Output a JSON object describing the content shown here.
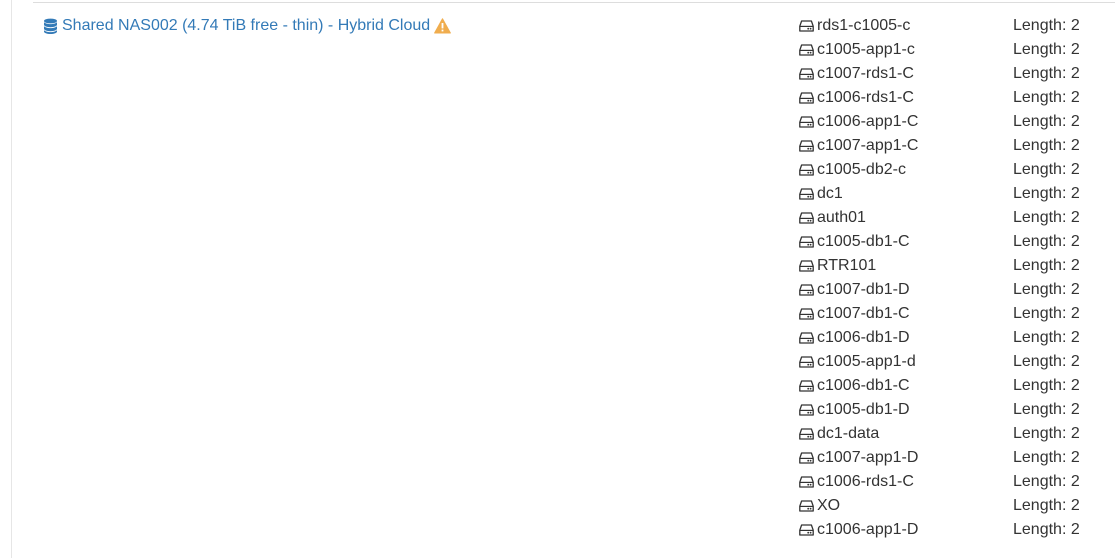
{
  "sr": {
    "name": "Shared NAS002 (4.74 TiB free - thin) - Hybrid Cloud",
    "icon": "database-icon",
    "warning_icon": "warning-icon",
    "link_color": "#337ab7",
    "warning_color": "#f0ad4e"
  },
  "vdis": [
    {
      "name": "rds1-c1005-c",
      "length": "Length: 2"
    },
    {
      "name": "c1005-app1-c",
      "length": "Length: 2"
    },
    {
      "name": "c1007-rds1-C",
      "length": "Length: 2"
    },
    {
      "name": "c1006-rds1-C",
      "length": "Length: 2"
    },
    {
      "name": "c1006-app1-C",
      "length": "Length: 2"
    },
    {
      "name": "c1007-app1-C",
      "length": "Length: 2"
    },
    {
      "name": "c1005-db2-c",
      "length": "Length: 2"
    },
    {
      "name": "dc1",
      "length": "Length: 2"
    },
    {
      "name": "auth01",
      "length": "Length: 2"
    },
    {
      "name": "c1005-db1-C",
      "length": "Length: 2"
    },
    {
      "name": "RTR101",
      "length": "Length: 2"
    },
    {
      "name": "c1007-db1-D",
      "length": "Length: 2"
    },
    {
      "name": "c1007-db1-C",
      "length": "Length: 2"
    },
    {
      "name": "c1006-db1-D",
      "length": "Length: 2"
    },
    {
      "name": "c1005-app1-d",
      "length": "Length: 2"
    },
    {
      "name": "c1006-db1-C",
      "length": "Length: 2"
    },
    {
      "name": "c1005-db1-D",
      "length": "Length: 2"
    },
    {
      "name": "dc1-data",
      "length": "Length: 2"
    },
    {
      "name": "c1007-app1-D",
      "length": "Length: 2"
    },
    {
      "name": "c1006-rds1-C",
      "length": "Length: 2"
    },
    {
      "name": "XO",
      "length": "Length: 2"
    },
    {
      "name": "c1006-app1-D",
      "length": "Length: 2"
    }
  ],
  "vdi_icon": "hdd-icon"
}
